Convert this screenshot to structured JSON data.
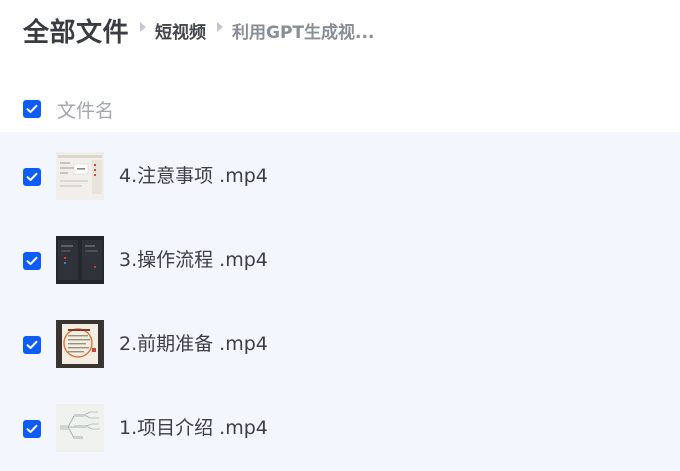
{
  "breadcrumb": {
    "root": "全部文件",
    "mid": "短视频",
    "current": "利用GPT生成视..."
  },
  "list_header": {
    "checked": true,
    "column_label": "文件名"
  },
  "files": [
    {
      "name": "4.注意事项 .mp4",
      "checked": true,
      "thumb_icon": "document-thumbnail"
    },
    {
      "name": "3.操作流程 .mp4",
      "checked": true,
      "thumb_icon": "dark-video-thumbnail"
    },
    {
      "name": "2.前期准备 .mp4",
      "checked": true,
      "thumb_icon": "certificate-thumbnail"
    },
    {
      "name": "1.项目介绍 .mp4",
      "checked": true,
      "thumb_icon": "mindmap-thumbnail"
    }
  ],
  "colors": {
    "checkbox_accent": "#0c5cf5",
    "list_background": "#f4f6fd"
  }
}
